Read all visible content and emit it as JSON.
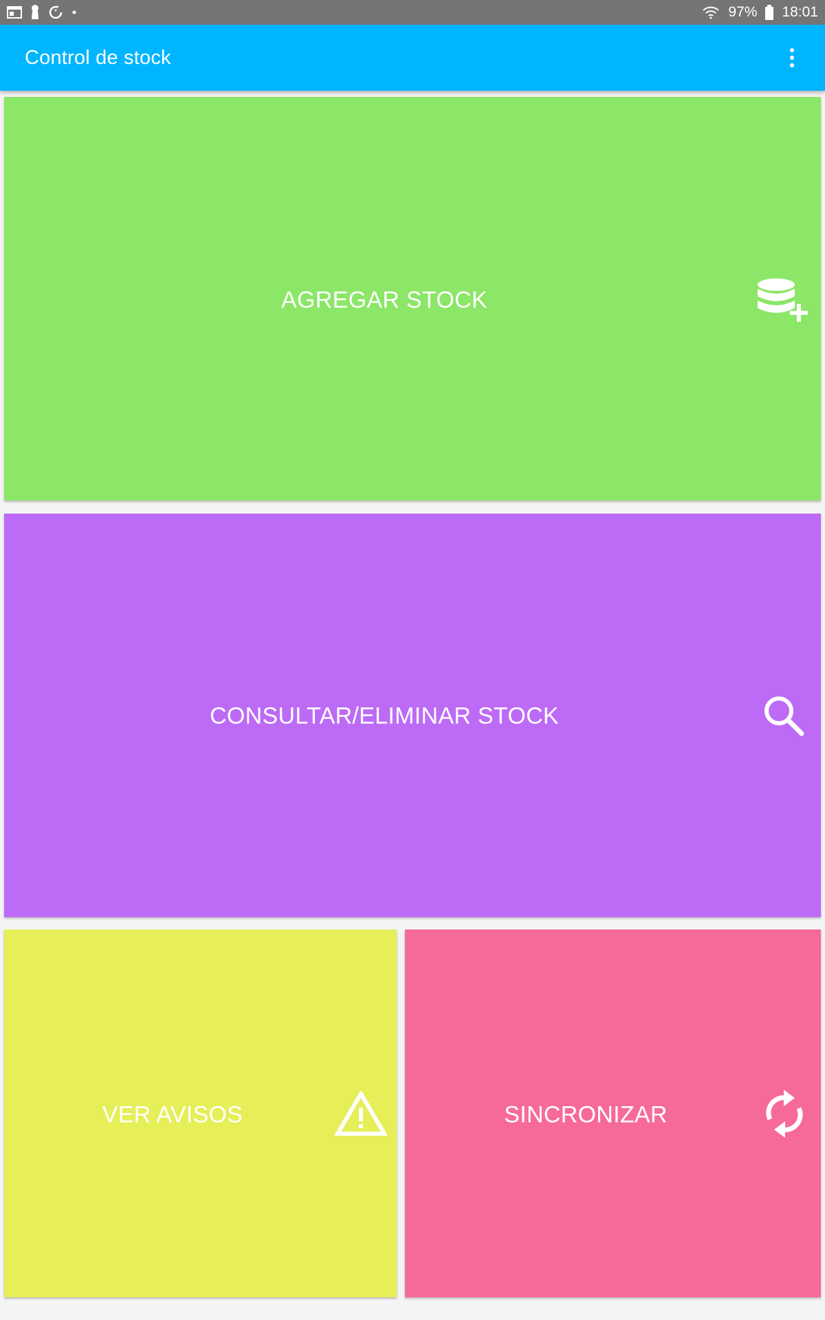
{
  "status_bar": {
    "battery": "97%",
    "time": "18:01",
    "icons": [
      "calendar-icon",
      "notification-icon",
      "sync-icon",
      "dot-icon",
      "wifi-icon",
      "battery-icon"
    ]
  },
  "app_bar": {
    "title": "Control de stock",
    "menu_icon": "more-vert-icon"
  },
  "tiles": [
    {
      "label": "AGREGAR STOCK",
      "icon": "database-add-icon",
      "color": "#8ce668"
    },
    {
      "label": "CONSULTAR/ELIMINAR STOCK",
      "icon": "search-icon",
      "color": "#bd6bf6"
    },
    {
      "label": "VER AVISOS",
      "icon": "warning-icon",
      "color": "#e6ee58"
    },
    {
      "label": "SINCRONIZAR",
      "icon": "sync-icon",
      "color": "#f66a9a"
    }
  ]
}
